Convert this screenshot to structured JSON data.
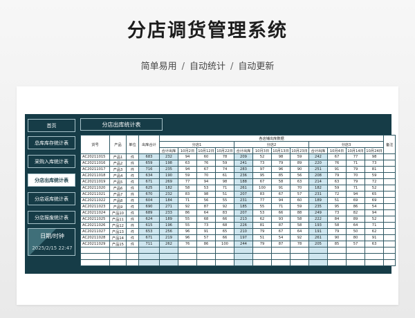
{
  "page": {
    "title": "分店调货管理系统",
    "subtitle": [
      "简单易用",
      "自动统计",
      "自动更新"
    ],
    "separator": "/"
  },
  "sidebar": {
    "items": [
      {
        "label": "首页",
        "active": false
      },
      {
        "label": "总库库存统计表",
        "active": false
      },
      {
        "label": "采购入库统计表",
        "active": false
      },
      {
        "label": "分店出库统计表",
        "active": true
      },
      {
        "label": "分店返库统计表",
        "active": false
      },
      {
        "label": "分店报废统计表",
        "active": false
      }
    ],
    "clock": {
      "label": "日期/时钟",
      "time": "2025/2/15 22:47"
    }
  },
  "sheet": {
    "title": "分店出库统计表",
    "headers": {
      "code": "货号",
      "product": "产品",
      "unit": "单位",
      "total": "出库合计",
      "group": "各店铺出库数据",
      "note": "备注",
      "stores": [
        {
          "name": "分店1",
          "cols": [
            "合计出库",
            "10月2日",
            "10月12日",
            "10月22日"
          ]
        },
        {
          "name": "分店2",
          "cols": [
            "合计出库",
            "10月3日",
            "10月13日",
            "10月23日"
          ]
        },
        {
          "name": "分店3",
          "cols": [
            "合计出库",
            "10月4日",
            "10月14日",
            "10月24日"
          ]
        }
      ]
    },
    "rows": [
      [
        "AC20211015",
        "产品1",
        "件",
        "683",
        "232",
        "94",
        "60",
        "78",
        "209",
        "52",
        "98",
        "59",
        "242",
        "67",
        "77",
        "98"
      ],
      [
        "AC20211016",
        "产品2",
        "件",
        "659",
        "198",
        "63",
        "76",
        "59",
        "241",
        "73",
        "79",
        "89",
        "220",
        "76",
        "71",
        "73"
      ],
      [
        "AC20211017",
        "产品3",
        "件",
        "716",
        "235",
        "94",
        "67",
        "74",
        "283",
        "97",
        "96",
        "90",
        "251",
        "91",
        "79",
        "81"
      ],
      [
        "AC20211018",
        "产品4",
        "件",
        "634",
        "190",
        "59",
        "70",
        "61",
        "236",
        "95",
        "85",
        "56",
        "208",
        "79",
        "70",
        "59"
      ],
      [
        "AC20211019",
        "产品5",
        "件",
        "671",
        "269",
        "77",
        "94",
        "98",
        "188",
        "67",
        "58",
        "63",
        "214",
        "63",
        "79",
        "72"
      ],
      [
        "AC20211020",
        "产品6",
        "件",
        "625",
        "182",
        "58",
        "53",
        "71",
        "261",
        "100",
        "91",
        "70",
        "182",
        "59",
        "71",
        "52"
      ],
      [
        "AC20211021",
        "产品7",
        "件",
        "670",
        "232",
        "83",
        "98",
        "51",
        "207",
        "83",
        "67",
        "57",
        "231",
        "72",
        "94",
        "65"
      ],
      [
        "AC20211022",
        "产品8",
        "件",
        "604",
        "184",
        "71",
        "56",
        "55",
        "231",
        "77",
        "94",
        "60",
        "189",
        "51",
        "69",
        "69"
      ],
      [
        "AC20211023",
        "产品9",
        "件",
        "690",
        "271",
        "92",
        "87",
        "92",
        "185",
        "55",
        "71",
        "59",
        "235",
        "95",
        "86",
        "54"
      ],
      [
        "AC20211024",
        "产品10",
        "件",
        "689",
        "233",
        "86",
        "64",
        "83",
        "207",
        "53",
        "66",
        "88",
        "249",
        "73",
        "82",
        "94"
      ],
      [
        "AC20211025",
        "产品11",
        "件",
        "624",
        "189",
        "55",
        "68",
        "66",
        "213",
        "62",
        "93",
        "58",
        "222",
        "84",
        "89",
        "52"
      ],
      [
        "AC20211026",
        "产品12",
        "件",
        "615",
        "196",
        "55",
        "73",
        "68",
        "226",
        "81",
        "87",
        "58",
        "193",
        "58",
        "64",
        "71"
      ],
      [
        "AC20211027",
        "产品13",
        "件",
        "653",
        "256",
        "96",
        "91",
        "65",
        "210",
        "79",
        "67",
        "64",
        "191",
        "79",
        "50",
        "62"
      ],
      [
        "AC20211028",
        "产品14",
        "件",
        "671",
        "219",
        "96",
        "57",
        "66",
        "197",
        "51",
        "54",
        "92",
        "261",
        "90",
        "80",
        "91"
      ],
      [
        "AC20211029",
        "产品15",
        "件",
        "711",
        "262",
        "76",
        "86",
        "100",
        "244",
        "79",
        "87",
        "78",
        "205",
        "85",
        "57",
        "63"
      ]
    ],
    "empty_rows": 3
  },
  "colors": {
    "panel": "#163c47",
    "highlight": "#cfe6ef",
    "border": "#a9c4cb"
  }
}
